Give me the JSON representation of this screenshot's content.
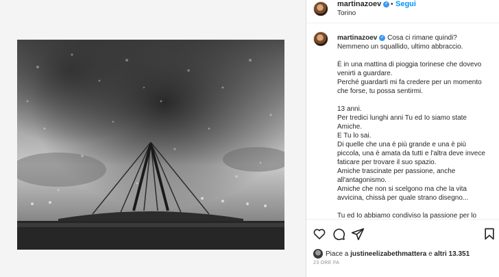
{
  "post": {
    "username": "martinazoev",
    "follow_label": "Segui",
    "separator": "•",
    "location": "Torino",
    "verified_mark": "✓",
    "caption_lines": [
      "Cosa ci rimane quindi?",
      "Nemmeno un squallido, ultimo abbraccio.",
      "",
      "È in una mattina di pioggia torinese che dovevo venirti a guardare.",
      "Perché guardarti mi fa credere per un momento che forse, tu possa sentirmi.",
      "",
      "13 anni.",
      "Per tredici lunghi anni Tu ed Io siamo state Amiche.",
      "E Tu lo sai.",
      "Di quelle che una è più grande e una è più piccola, una è amata da tutti e l'altra deve invece faticare per trovare il suo spazio.",
      "Amiche trascinate per passione, anche all'antagonismo.",
      "Amiche che non si scelgono ma che la vita avvicina, chissà per quale strano disegno...",
      "",
      "Tu ed Io abbiamo condiviso la passione per lo"
    ],
    "likes": {
      "prefix": "Piace a",
      "liker": "justineelizabethmattera",
      "conj": "e",
      "others": "altri 13.351"
    },
    "timestamp": "23 ORE FA"
  },
  "icons": {
    "like": "heart-icon",
    "comment": "comment-icon",
    "share": "share-icon",
    "save": "bookmark-icon"
  }
}
